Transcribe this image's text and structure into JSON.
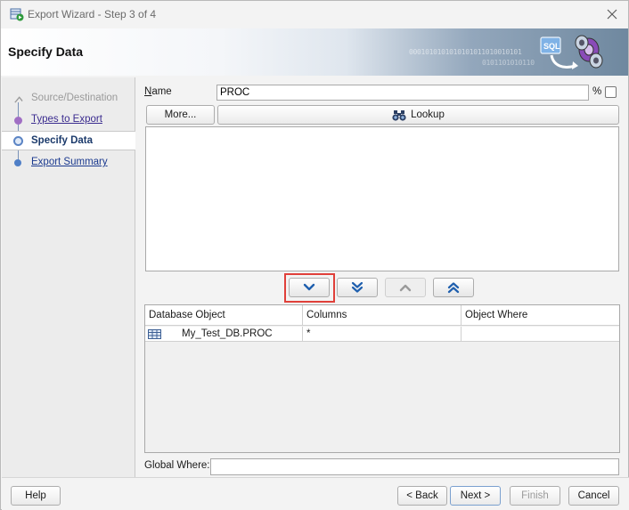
{
  "window": {
    "title": "Export Wizard - Step 3 of 4",
    "banner_title": "Specify Data",
    "banner_bits_1": "0001010101010101011010010101",
    "banner_bits_2": "0101101010110",
    "banner_logo_text": "SQL"
  },
  "steps": [
    {
      "label": "Source/Destination",
      "state": "done"
    },
    {
      "label": "Types to Export",
      "state": "visited"
    },
    {
      "label": "Specify Data",
      "state": "current"
    },
    {
      "label": "Export Summary",
      "state": "pending"
    }
  ],
  "form": {
    "name_label": "Name",
    "name_mnemonic": "N",
    "name_rest": "ame",
    "name_value": "PROC",
    "percent_label": "%",
    "percent_checked": false,
    "more_button": "More...",
    "lookup_button": "Lookup"
  },
  "move_buttons": [
    {
      "name": "move-down",
      "icon": "chevron-down-icon",
      "enabled": true,
      "highlighted": true
    },
    {
      "name": "move-all-down",
      "icon": "double-chevron-down-icon",
      "enabled": true
    },
    {
      "name": "move-up",
      "icon": "chevron-up-icon",
      "enabled": false
    },
    {
      "name": "move-all-up",
      "icon": "double-chevron-up-icon",
      "enabled": true
    }
  ],
  "table": {
    "columns": [
      "Database Object",
      "Columns",
      "Object Where"
    ],
    "rows": [
      {
        "object": "My_Test_DB.PROC",
        "columns": "*",
        "where": ""
      }
    ]
  },
  "global_where": {
    "label": "Global Where:",
    "value": ""
  },
  "footer": {
    "help": "Help",
    "back": "< Back",
    "next": "Next >",
    "finish": "Finish",
    "cancel": "Cancel"
  },
  "colors": {
    "highlight": "#e0403a",
    "accent": "#1b3a6b"
  }
}
